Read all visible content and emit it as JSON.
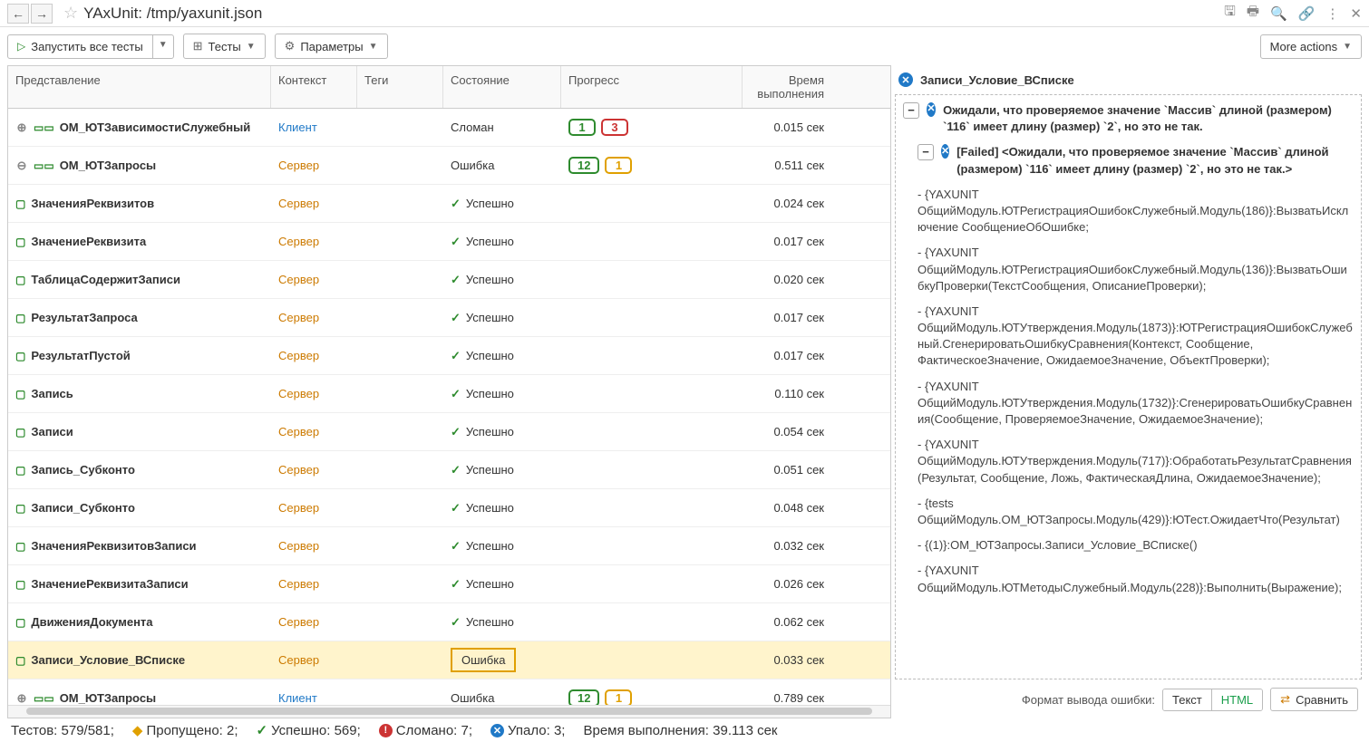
{
  "title": "YAxUnit: /tmp/yaxunit.json",
  "toolbar": {
    "run_all": "Запустить все тесты",
    "tests": "Тесты",
    "params": "Параметры",
    "more": "More actions"
  },
  "table": {
    "headers": {
      "name": "Представление",
      "ctx": "Контекст",
      "tags": "Теги",
      "state": "Состояние",
      "progress": "Прогресс",
      "time": "Время выполнения"
    },
    "rows": [
      {
        "type": "group",
        "expand": "plus",
        "indent": 1,
        "name": "ОМ_ЮТЗависимостиСлужебный",
        "ctx": "Клиент",
        "ctxCls": "client",
        "state": "Сломан",
        "prog": [
          {
            "v": "1",
            "c": "g"
          },
          {
            "v": "3",
            "c": "r"
          }
        ],
        "time": "0.015 сек"
      },
      {
        "type": "group",
        "expand": "minus",
        "indent": 1,
        "name": "ОМ_ЮТЗапросы",
        "ctx": "Сервер",
        "ctxCls": "server",
        "state": "Ошибка",
        "prog": [
          {
            "v": "12",
            "c": "g"
          },
          {
            "v": "1",
            "c": "y"
          }
        ],
        "time": "0.511 сек"
      },
      {
        "type": "leaf",
        "indent": 2,
        "name": "ЗначенияРеквизитов",
        "ctx": "Сервер",
        "ctxCls": "server",
        "state": "Успешно",
        "ok": true,
        "time": "0.024 сек"
      },
      {
        "type": "leaf",
        "indent": 2,
        "name": "ЗначениеРеквизита",
        "ctx": "Сервер",
        "ctxCls": "server",
        "state": "Успешно",
        "ok": true,
        "time": "0.017 сек"
      },
      {
        "type": "leaf",
        "indent": 2,
        "name": "ТаблицаСодержитЗаписи",
        "ctx": "Сервер",
        "ctxCls": "server",
        "state": "Успешно",
        "ok": true,
        "time": "0.020 сек"
      },
      {
        "type": "leaf",
        "indent": 2,
        "name": "РезультатЗапроса",
        "ctx": "Сервер",
        "ctxCls": "server",
        "state": "Успешно",
        "ok": true,
        "time": "0.017 сек"
      },
      {
        "type": "leaf",
        "indent": 2,
        "name": "РезультатПустой",
        "ctx": "Сервер",
        "ctxCls": "server",
        "state": "Успешно",
        "ok": true,
        "time": "0.017 сек"
      },
      {
        "type": "leaf",
        "indent": 2,
        "name": "Запись",
        "ctx": "Сервер",
        "ctxCls": "server",
        "state": "Успешно",
        "ok": true,
        "time": "0.110 сек"
      },
      {
        "type": "leaf",
        "indent": 2,
        "name": "Записи",
        "ctx": "Сервер",
        "ctxCls": "server",
        "state": "Успешно",
        "ok": true,
        "time": "0.054 сек"
      },
      {
        "type": "leaf",
        "indent": 2,
        "name": "Запись_Субконто",
        "ctx": "Сервер",
        "ctxCls": "server",
        "state": "Успешно",
        "ok": true,
        "time": "0.051 сек"
      },
      {
        "type": "leaf",
        "indent": 2,
        "name": "Записи_Субконто",
        "ctx": "Сервер",
        "ctxCls": "server",
        "state": "Успешно",
        "ok": true,
        "time": "0.048 сек"
      },
      {
        "type": "leaf",
        "indent": 2,
        "name": "ЗначенияРеквизитовЗаписи",
        "ctx": "Сервер",
        "ctxCls": "server",
        "state": "Успешно",
        "ok": true,
        "time": "0.032 сек"
      },
      {
        "type": "leaf",
        "indent": 2,
        "name": "ЗначениеРеквизитаЗаписи",
        "ctx": "Сервер",
        "ctxCls": "server",
        "state": "Успешно",
        "ok": true,
        "time": "0.026 сек"
      },
      {
        "type": "leaf",
        "indent": 2,
        "name": "ДвиженияДокумента",
        "ctx": "Сервер",
        "ctxCls": "server",
        "state": "Успешно",
        "ok": true,
        "time": "0.062 сек"
      },
      {
        "type": "leaf",
        "indent": 2,
        "name": "Записи_Условие_ВСписке",
        "ctx": "Сервер",
        "ctxCls": "server",
        "state": "Ошибка",
        "ok": false,
        "selected": true,
        "time": "0.033 сек"
      },
      {
        "type": "group",
        "expand": "plus",
        "indent": 1,
        "name": "ОМ_ЮТЗапросы",
        "ctx": "Клиент",
        "ctxCls": "client",
        "state": "Ошибка",
        "prog": [
          {
            "v": "12",
            "c": "g"
          },
          {
            "v": "1",
            "c": "y"
          }
        ],
        "time": "0.789 сек"
      }
    ]
  },
  "detail": {
    "title": "Записи_Условие_ВСписке",
    "msg1": "Ожидали, что проверяемое значение `Массив` длиной (размером) `116` имеет длину (размер) `2`, но это не так.",
    "msg2": "[Failed] <Ожидали, что проверяемое значение `Массив` длиной (размером) `116` имеет длину (размер) `2`, но это не так.>",
    "stack": [
      " - {YAXUNIT ОбщийМодуль.ЮТРегистрацияОшибокСлужебный.Модуль(186)}:ВызватьИсключение СообщениеОбОшибке;",
      " - {YAXUNIT ОбщийМодуль.ЮТРегистрацияОшибокСлужебный.Модуль(136)}:ВызватьОшибкуПроверки(ТекстСообщения, ОписаниеПроверки);",
      " - {YAXUNIT ОбщийМодуль.ЮТУтверждения.Модуль(1873)}:ЮТРегистрацияОшибокСлужебный.СгенерироватьОшибкуСравнения(Контекст, Сообщение, ФактическоеЗначение, ОжидаемоеЗначение, ОбъектПроверки);",
      " - {YAXUNIT ОбщийМодуль.ЮТУтверждения.Модуль(1732)}:СгенерироватьОшибкуСравнения(Сообщение, ПроверяемоеЗначение, ОжидаемоеЗначение);",
      " - {YAXUNIT ОбщийМодуль.ЮТУтверждения.Модуль(717)}:ОбработатьРезультатСравнения(Результат, Сообщение, Ложь, ФактическаяДлина, ОжидаемоеЗначение);",
      " - {tests ОбщийМодуль.ОМ_ЮТЗапросы.Модуль(429)}:ЮТест.ОжидаетЧто(Результат)",
      " - {(1)}:ОМ_ЮТЗапросы.Записи_Условие_ВСписке()",
      " - {YAXUNIT ОбщийМодуль.ЮТМетодыСлужебный.Модуль(228)}:Выполнить(Выражение);"
    ],
    "fmt_label": "Формат вывода ошибки:",
    "fmt_text": "Текст",
    "fmt_html": "HTML",
    "compare": "Сравнить"
  },
  "status": {
    "tests": "Тестов: 579/581;",
    "skipped": "Пропущено: 2;",
    "passed": "Успешно: 569;",
    "broken": "Сломано: 7;",
    "failed": "Упало: 3;",
    "duration": "Время выполнения: 39.113 сек"
  }
}
